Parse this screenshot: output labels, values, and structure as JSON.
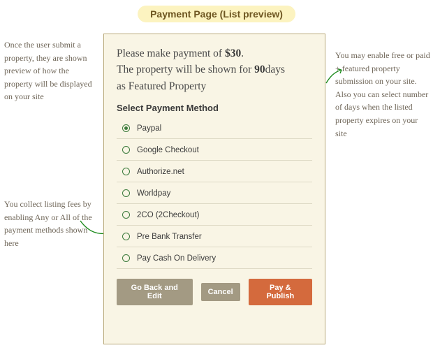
{
  "title": "Payment Page (List preview)",
  "annotations": {
    "left1": "Once the user submit a property, they are shown preview of how the property will be displayed on your site",
    "left2": "You collect listing fees by enabling Any or All of the payment methods shown here",
    "right1": "You may enable free or paid + featured property submission on your site.\nAlso you can select number of days when the listed property expires on your site"
  },
  "panel": {
    "lead_prefix": "Please make payment of ",
    "amount": "$30",
    "lead_suffix": ".",
    "line2_a": "The property will be shown for ",
    "days": "90",
    "line2_b": "days",
    "line3": "as Featured Property",
    "section": "Select Payment Method",
    "options": [
      "Paypal",
      "Google Checkout",
      "Authorize.net",
      "Worldpay",
      "2CO (2Checkout)",
      "Pre Bank Transfer",
      "Pay Cash On Delivery"
    ],
    "selected_index": 0,
    "buttons": {
      "back": "Go Back and Edit",
      "cancel": "Cancel",
      "publish": "Pay & Publish"
    }
  }
}
